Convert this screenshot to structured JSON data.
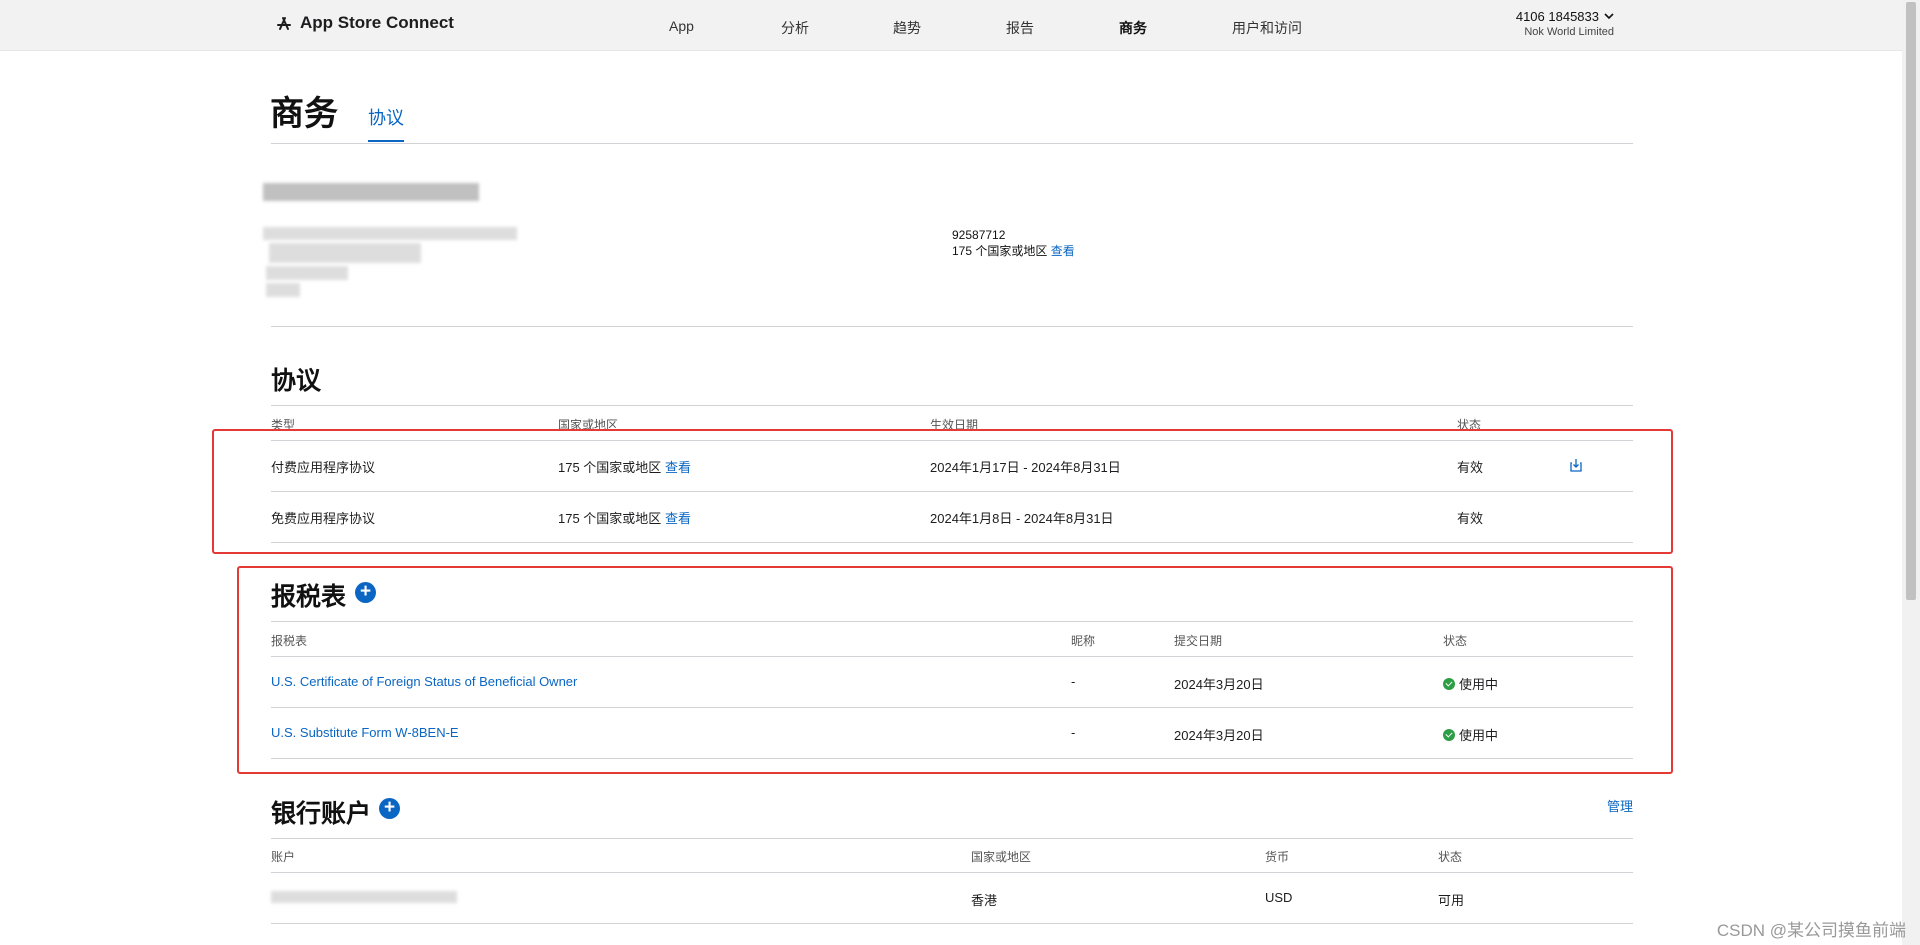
{
  "topbar": {
    "brand": "App Store Connect",
    "nav": [
      "App",
      "分析",
      "趋势",
      "报告",
      "商务",
      "用户和访问"
    ],
    "active_nav": "商务",
    "account_id": "4106 1845833",
    "account_org": "Nok World Limited"
  },
  "page": {
    "title": "商务",
    "tab": "协议"
  },
  "entity": {
    "id_number": "92587712",
    "regions_text": "175 个国家或地区",
    "regions_link": "查看"
  },
  "agreements": {
    "title": "协议",
    "columns": [
      "类型",
      "国家或地区",
      "生效日期",
      "状态"
    ],
    "rows": [
      {
        "type": "付费应用程序协议",
        "regions": "175 个国家或地区",
        "link": "查看",
        "dates": "2024年1月17日 - 2024年8月31日",
        "status": "有效"
      },
      {
        "type": "免费应用程序协议",
        "regions": "175 个国家或地区",
        "link": "查看",
        "dates": "2024年1月8日 - 2024年8月31日",
        "status": "有效"
      }
    ]
  },
  "tax_forms": {
    "title": "报税表",
    "columns": [
      "报税表",
      "昵称",
      "提交日期",
      "状态"
    ],
    "rows": [
      {
        "form": "U.S. Certificate of Foreign Status of Beneficial Owner",
        "nickname": "-",
        "date": "2024年3月20日",
        "status": "使用中"
      },
      {
        "form": "U.S. Substitute Form W-8BEN-E",
        "nickname": "-",
        "date": "2024年3月20日",
        "status": "使用中"
      }
    ]
  },
  "bank_accounts": {
    "title": "银行账户",
    "manage": "管理",
    "columns": [
      "账户",
      "国家或地区",
      "货币",
      "状态"
    ],
    "rows": [
      {
        "region": "香港",
        "currency": "USD",
        "status": "可用"
      }
    ]
  },
  "watermark": "CSDN @某公司摸鱼前端",
  "colors": {
    "accent": "#0a66c2",
    "highlight_box": "#e53935",
    "status_ok": "#2e9e46"
  }
}
